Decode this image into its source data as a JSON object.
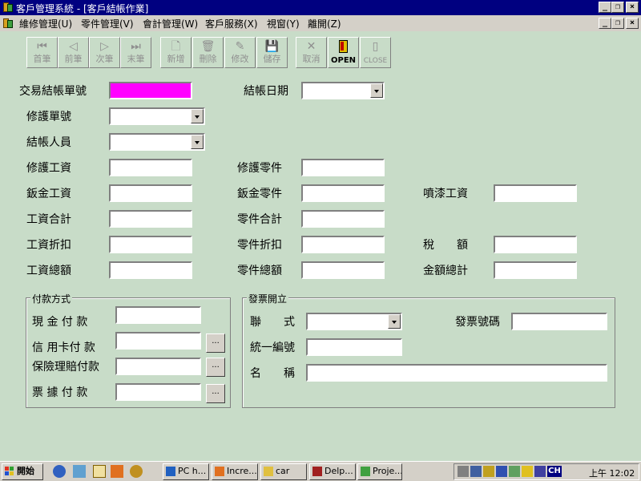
{
  "window": {
    "title": "客戶管理系統 - [客戶結帳作業]"
  },
  "caption_buttons": [
    "_",
    "❐",
    "×"
  ],
  "menu": [
    {
      "label": "維修管理(U)"
    },
    {
      "label": "零件管理(V)"
    },
    {
      "label": "會計管理(W)"
    },
    {
      "label": "客戶服務(X)"
    },
    {
      "label": "視窗(Y)"
    },
    {
      "label": "離開(Z)"
    }
  ],
  "toolbar": [
    {
      "label": "首筆",
      "icon": "first-record-icon",
      "glyph": "⏮",
      "enabled": false
    },
    {
      "label": "前筆",
      "icon": "prev-record-icon",
      "glyph": "◁",
      "enabled": false
    },
    {
      "label": "次筆",
      "icon": "next-record-icon",
      "glyph": "▷",
      "enabled": false
    },
    {
      "label": "末筆",
      "icon": "last-record-icon",
      "glyph": "⏭",
      "enabled": false
    },
    {
      "label": "新增",
      "icon": "new-document-icon",
      "glyph": "🗋",
      "enabled": false
    },
    {
      "label": "刪除",
      "icon": "trash-icon",
      "glyph": "🗑",
      "enabled": false
    },
    {
      "label": "修改",
      "icon": "edit-icon",
      "glyph": "✎",
      "enabled": false
    },
    {
      "label": "儲存",
      "icon": "save-disk-icon",
      "glyph": "💾",
      "enabled": false
    },
    {
      "label": "取消",
      "icon": "cancel-x-icon",
      "glyph": "✕",
      "enabled": false
    },
    {
      "label": "OPEN",
      "icon": "open-door-icon",
      "glyph": "▮",
      "enabled": true
    },
    {
      "label": "CLOSE",
      "icon": "close-door-icon",
      "glyph": "▯",
      "enabled": false
    }
  ],
  "form": {
    "trans_no_label": "交易結帳單號",
    "date_label": "結帳日期",
    "repair_no_label": "修護單號",
    "cashier_label": "結帳人員",
    "repair_wage_label": "修護工資",
    "repair_parts_label": "修護零件",
    "sheet_wage_label": "鈑金工資",
    "sheet_parts_label": "鈑金零件",
    "paint_wage_label": "噴漆工資",
    "wage_total_label": "工資合計",
    "parts_total_label": "零件合計",
    "wage_discount_label": "工資折扣",
    "parts_discount_label": "零件折扣",
    "tax_label": "稅　　額",
    "wage_sum_label": "工資總額",
    "parts_sum_label": "零件總額",
    "grand_total_label": "金額總計"
  },
  "payment": {
    "title": "付款方式",
    "cash_label": "現 金 付 款",
    "credit_label": "信 用卡付 款",
    "insurance_label": "保險理賠付款",
    "cheque_label": "票 據 付 款",
    "browse_label": "..."
  },
  "invoice": {
    "title": "發票開立",
    "style_label": "聯　　式",
    "invoice_no_label": "發票號碼",
    "tax_id_label": "統一編號",
    "name_label": "名　　稱"
  },
  "taskbar": {
    "start_label": "開始",
    "tasks": [
      {
        "label": "PC h..."
      },
      {
        "label": "Incre..."
      },
      {
        "label": "car"
      },
      {
        "label": "Delp..."
      },
      {
        "label": "Proje..."
      }
    ],
    "clock": "上午 12:02",
    "ime": "CH"
  },
  "colors": {
    "titlebar": "#000080",
    "client_bg": "#c8dcc8",
    "highlight_field": "#ff00ff"
  }
}
